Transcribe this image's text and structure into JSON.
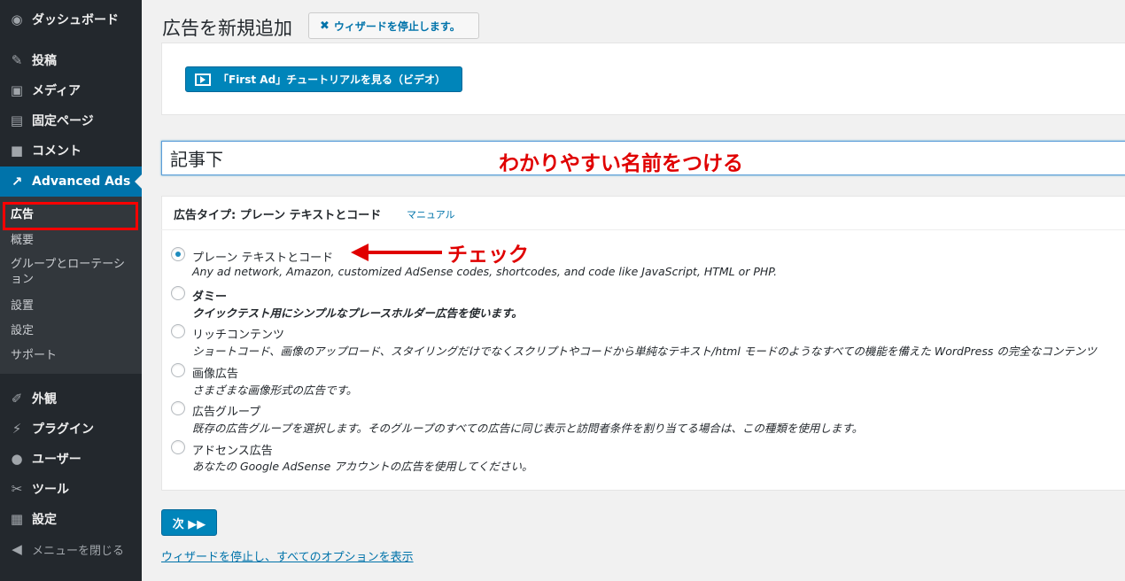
{
  "sidebar": {
    "items": [
      {
        "icon": "dashboard-icon",
        "label": "ダッシュボード"
      },
      {
        "icon": "pin-icon",
        "label": "投稿"
      },
      {
        "icon": "media-icon",
        "label": "メディア"
      },
      {
        "icon": "page-icon",
        "label": "固定ページ"
      },
      {
        "icon": "comment-icon",
        "label": "コメント"
      },
      {
        "icon": "chart-icon",
        "label": "Advanced Ads"
      },
      {
        "icon": "appearance-icon",
        "label": "外観"
      },
      {
        "icon": "plugin-icon",
        "label": "プラグイン"
      },
      {
        "icon": "user-icon",
        "label": "ユーザー"
      },
      {
        "icon": "wrench-icon",
        "label": "ツール"
      },
      {
        "icon": "settings-icon",
        "label": "設定"
      }
    ],
    "submenu": [
      "広告",
      "概要",
      "グループとローテーション",
      "設置",
      "設定",
      "サポート"
    ],
    "collapse_label": "メニューを閉じる"
  },
  "header": {
    "title": "広告を新規追加",
    "stop_wizard": "ウィザードを停止します。"
  },
  "video_button": "「First Ad」チュートリアルを見る（ビデオ）",
  "ad_name": {
    "value": "記事下"
  },
  "annotations": {
    "name_hint": "わかりやすい名前をつける",
    "check_hint": "チェック",
    "color": "#e00000"
  },
  "ad_type": {
    "title": "広告タイプ: プレーン テキストとコード",
    "manual": "マニュアル",
    "options": [
      {
        "label": "プレーン テキストとコード",
        "desc": "Any ad network, Amazon, customized AdSense codes, shortcodes, and code like JavaScript, HTML or PHP.",
        "checked": true
      },
      {
        "label": "ダミー",
        "desc": "クイックテスト用にシンプルなプレースホルダー広告を使います。",
        "checked": false
      },
      {
        "label": "リッチコンテンツ",
        "desc": "ショートコード、画像のアップロード、スタイリングだけでなくスクリプトやコードから単純なテキスト/html モードのようなすべての機能を備えた WordPress の完全なコンテンツ",
        "checked": false
      },
      {
        "label": "画像広告",
        "desc": "さまざまな画像形式の広告です。",
        "checked": false
      },
      {
        "label": "広告グループ",
        "desc": "既存の広告グループを選択します。そのグループのすべての広告に同じ表示と訪問者条件を割り当てる場合は、この種類を使用します。",
        "checked": false
      },
      {
        "label": "アドセンス広告",
        "desc": "あなたの Google AdSense アカウントの広告を使用してください。",
        "checked": false
      }
    ]
  },
  "next_button": "次 ▶▶",
  "bottom_link": "ウィザードを停止し、すべてのオプションを表示",
  "colors": {
    "accent": "#0073aa",
    "button": "#0085ba",
    "sidebar": "#23282d"
  }
}
